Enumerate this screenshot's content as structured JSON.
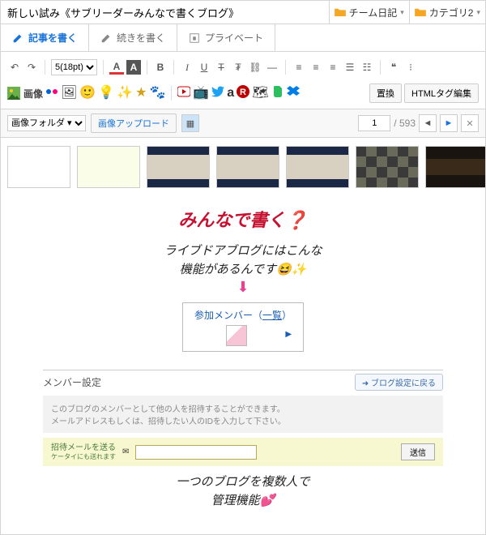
{
  "title": "新しい試み《サブリーダーみんなで書くブログ》",
  "cat1": "チーム日記",
  "cat2": "カテゴリ2",
  "tabs": {
    "write": "記事を書く",
    "cont": "続きを書く",
    "priv": "プライベート"
  },
  "font_size": "5(18pt)",
  "img_label": "画像",
  "btn_replace": "置換",
  "btn_html": "HTMLタグ編集",
  "img_folder": "画像フォルダ ▾",
  "img_upload": "画像アップロード",
  "page_cur": "1",
  "page_total": "/ 593",
  "content": {
    "heading": "みんなで書く❓",
    "l1": "ライブドアブログにはこんな",
    "l2": "機能があるんです",
    "link_pre": "参加メンバー（",
    "link_u": "一覧",
    "link_post": "）",
    "panel_h": "メンバー設定",
    "blog_set": "➜ ブログ設定に戻る",
    "g1": "このブログのメンバーとして他の人を招待することができます。",
    "g2": "メールアドレスもしくは、招待したい人のIDを入力して下さい。",
    "y_lbl1": "招待メールを送る",
    "y_lbl2": "ケータイにも送れます",
    "y_send": "送信",
    "b1": "一つのブログを複数人で",
    "b2": "管理機能"
  }
}
